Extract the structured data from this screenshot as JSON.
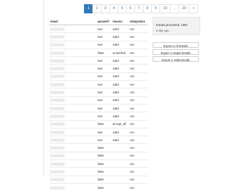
{
  "pagination": {
    "pages": [
      "1",
      "2",
      "3",
      "4",
      "5",
      "6",
      "7",
      "8",
      "9",
      "10"
    ],
    "active": "1",
    "ellipsis": "…",
    "last": "20",
    "next": "»"
  },
  "table": {
    "headers": [
      "email",
      "passed?",
      "reason",
      "integration"
    ],
    "rows": [
      [
        "[redacted]",
        "true",
        "valid",
        "csv"
      ],
      [
        "[redacted]",
        "true",
        "valid",
        "csv"
      ],
      [
        "[redacted]",
        "true",
        "valid",
        "csv"
      ],
      [
        "[redacted]",
        "false",
        "unverified",
        "csv"
      ],
      [
        "[redacted]",
        "true",
        "valid",
        "csv"
      ],
      [
        "[redacted]",
        "true",
        "valid",
        "csv"
      ],
      [
        "[redacted]",
        "true",
        "valid",
        "csv"
      ],
      [
        "[redacted]",
        "true",
        "valid",
        "csv"
      ],
      [
        "[redacted]",
        "true",
        "valid",
        "csv"
      ],
      [
        "[redacted]",
        "true",
        "valid",
        "csv"
      ],
      [
        "[redacted]",
        "true",
        "valid",
        "csv"
      ],
      [
        "[redacted]",
        "true",
        "valid",
        "csv"
      ],
      [
        "[redacted]",
        "false",
        "accept_all",
        "csv"
      ],
      [
        "[redacted]",
        "true",
        "valid",
        "csv"
      ],
      [
        "[redacted]",
        "true",
        "valid",
        "csv"
      ],
      [
        "[redacted]",
        "false",
        "",
        "csv"
      ],
      [
        "[redacted]",
        "false",
        "",
        "csv"
      ],
      [
        "[redacted]",
        "false",
        "",
        "csv"
      ],
      [
        "[redacted]",
        "false",
        "",
        "csv"
      ],
      [
        "[redacted]",
        "false",
        "",
        "csv"
      ],
      [
        "[redacted]",
        "false",
        "",
        "csv"
      ]
    ]
  },
  "status": {
    "processed": "Emails processed: 1000",
    "time": "a day ago"
  },
  "exports": [
    "Export 1 All Emails",
    "Export 1 Invalid Emails",
    "Export 1 Valid Emails"
  ]
}
